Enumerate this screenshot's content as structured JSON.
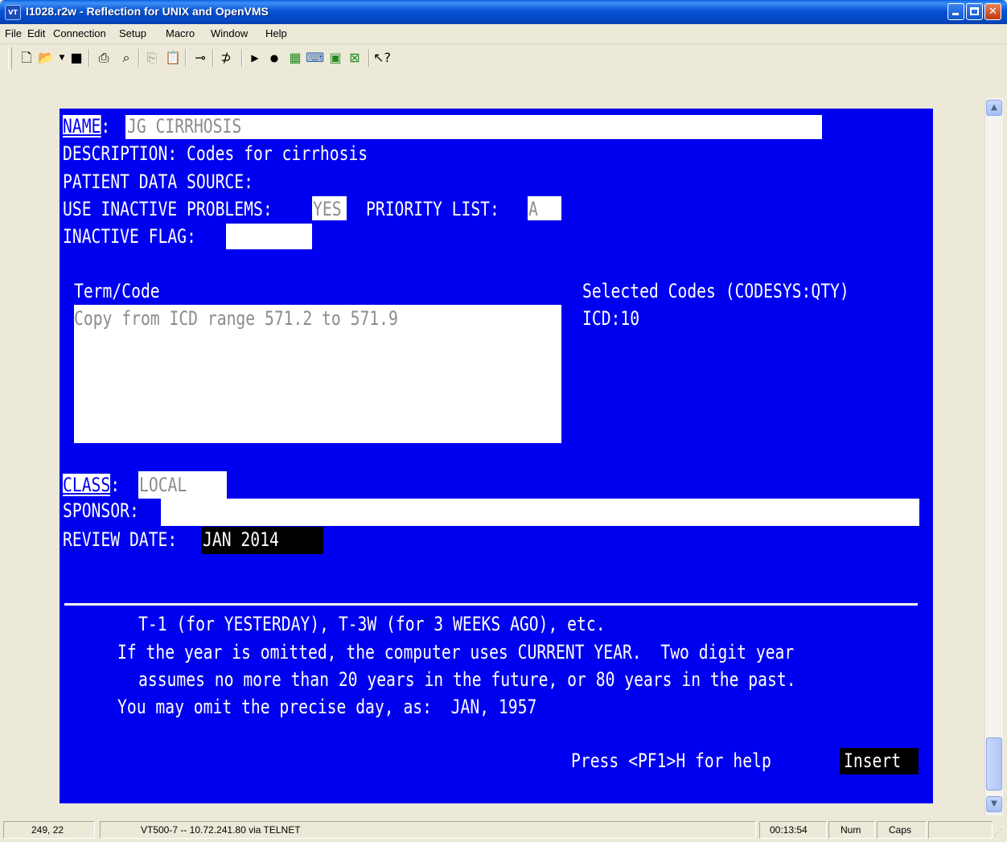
{
  "window": {
    "title": "I1028.r2w - Reflection for UNIX and OpenVMS",
    "icon_label": "VT",
    "controls": [
      "minimize",
      "maximize",
      "close"
    ]
  },
  "menu": {
    "items": [
      "File",
      "Edit",
      "Connection",
      "Setup",
      "Macro",
      "Window",
      "Help"
    ]
  },
  "toolbar": {
    "icons": [
      "new-icon",
      "open-icon",
      "dropdown-icon",
      "save-icon",
      "print-icon",
      "find-icon",
      "copy-icon",
      "paste-icon",
      "connect-icon",
      "disconnect-icon",
      "play-macro-icon",
      "record-macro-icon",
      "setup-display-icon",
      "setup-keyboard-icon",
      "setup-terminal-icon",
      "setup-hosts-icon",
      "help-pointer-icon"
    ]
  },
  "terminal": {
    "name_label": "NAME",
    "name_value": "JG CIRRHOSIS",
    "description_line": "DESCRIPTION: Codes for cirrhosis",
    "patient_data_source_line": "PATIENT DATA SOURCE:",
    "use_inactive_label": "USE INACTIVE PROBLEMS:",
    "use_inactive_value": "YES",
    "priority_label": "PRIORITY LIST:",
    "priority_value": "A",
    "inactive_flag_label": "INACTIVE FLAG:",
    "term_code_header": "Term/Code",
    "term_code_value": "Copy from ICD range 571.2 to 571.9",
    "selected_codes_header": "Selected Codes (CODESYS:QTY)",
    "selected_codes_value": "ICD:10",
    "class_label": "CLASS",
    "class_value": "LOCAL",
    "sponsor_label": "SPONSOR:",
    "review_date_label": "REVIEW DATE:",
    "review_date_value": "JAN 2014",
    "help_lines": [
      "T-1 (for YESTERDAY), T-3W (for 3 WEEKS AGO), etc.",
      "If the year is omitted, the computer uses CURRENT YEAR.  Two digit year",
      "assumes no more than 20 years in the future, or 80 years in the past.",
      "You may omit the precise day, as:  JAN, 1957"
    ],
    "help_hint": "Press <PF1>H for help",
    "mode": "Insert"
  },
  "status": {
    "cursor_position": "249, 22",
    "connection": "VT500-7 -- 10.72.241.80 via TELNET",
    "elapsed": "00:13:54",
    "num": "Num",
    "caps": "Caps"
  }
}
